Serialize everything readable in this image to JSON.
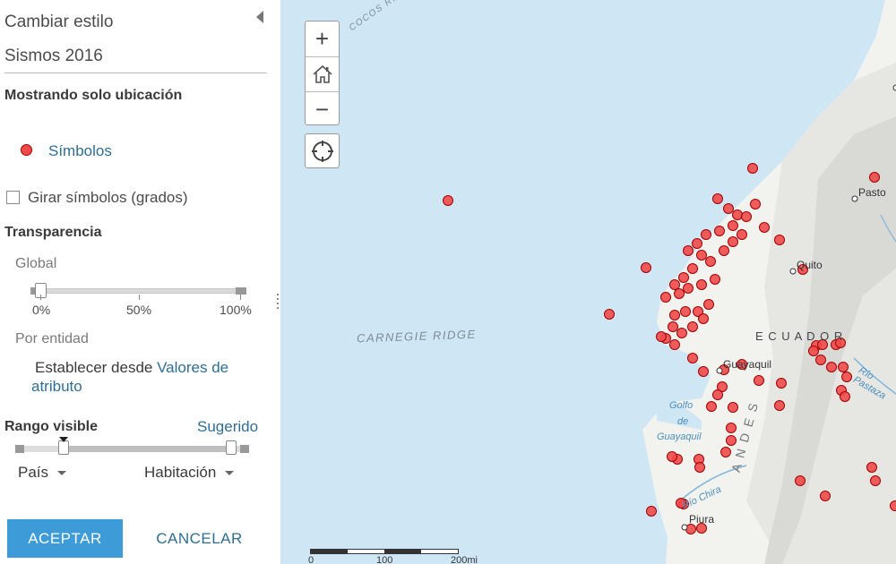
{
  "panel": {
    "title": "Cambiar estilo",
    "layer_name": "Sismos 2016",
    "mode_heading": "Mostrando solo ubicación",
    "symbols_link": "Símbolos",
    "rotate_label": "Girar símbolos (grados)",
    "rotate_checked": false,
    "transparency_heading": "Transparencia",
    "global_label": "Global",
    "transparency_value_percent": 0,
    "ticks": [
      "0%",
      "50%",
      "100%"
    ],
    "per_entity_label": "Por entidad",
    "set_from_prefix": "Establecer desde ",
    "set_from_link1": "Valores de",
    "set_from_link2": "atributo",
    "visible_range_heading": "Rango visible",
    "suggested_link": "Sugerido",
    "range_min": "País",
    "range_max": "Habitación",
    "ok_button": "ACEPTAR",
    "cancel_button": "CANCELAR",
    "accent_color": "#3d9bd8",
    "link_color": "#2e6e96",
    "symbol_color": "#f04a4a"
  },
  "map": {
    "zoom_in": "+",
    "zoom_out": "−",
    "home_icon": "home-icon",
    "locate_icon": "crosshair-icon",
    "labels": {
      "cocos_ridge": "COCOS RIDGE",
      "carnegie_ridge": "CARNEGIE RIDGE",
      "ecuador": "E C U A D O R",
      "andes": "A N D E S",
      "pasto": "Pasto",
      "quito": "Quito",
      "guayaquil": "Guayaquil",
      "piura": "Piura",
      "golfo1": "Golfo",
      "golfo2": "de",
      "golfo3": "Guayaquil",
      "rio_chira": "Río Chira",
      "rio_pastaza": "Río Pastaza"
    },
    "scale": [
      "0",
      "100",
      "200mi"
    ]
  }
}
